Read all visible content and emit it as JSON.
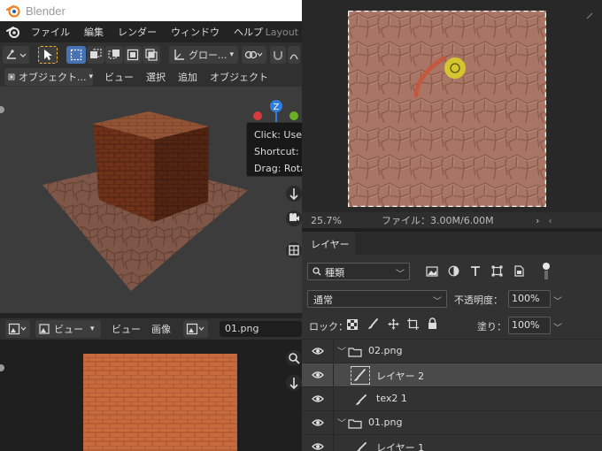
{
  "blender": {
    "app_title": "Blender",
    "menu": [
      "ファイル",
      "編集",
      "レンダー",
      "ウィンドウ",
      "ヘルプ"
    ],
    "workspace_tab": "Layout",
    "tool_dropdown": "グロー...",
    "mode_dropdown": "オブジェクト...",
    "header_menu": [
      "ビュー",
      "選択",
      "追加",
      "オブジェクト"
    ],
    "tooltip": {
      "line1": "Click: Use a",
      "line2": "Shortcut: (C",
      "line3": "Drag: Rota"
    },
    "gizmo_axis_label": "Z",
    "image_editor": {
      "view_dropdown": "ビュー",
      "menu": [
        "ビュー",
        "画像"
      ],
      "filename": "01.png"
    },
    "colors": {
      "cube_side_dark": "#5a2714",
      "cube_side_mid": "#7a3a1e",
      "cube_top": "#8c4728",
      "floor": "#8e6352",
      "texture_orange": "#c56a3e",
      "accent_blue": "#4772b3"
    }
  },
  "photoshop": {
    "status": {
      "zoom": "25.7%",
      "file_info": "ファイル：3.00M/6.00M"
    },
    "panel_tab": "レイヤー",
    "filter_kind": "種類",
    "blend_mode": "通常",
    "opacity_label": "不透明度：",
    "opacity_value": "100%",
    "lock_label": "ロック：",
    "fill_label": "塗り：",
    "fill_value": "100%",
    "layers": [
      {
        "name": "02.png",
        "kind": "group",
        "expanded": true
      },
      {
        "name": "レイヤー 2",
        "kind": "layer",
        "active": true
      },
      {
        "name": "tex2 1",
        "kind": "layer"
      },
      {
        "name": "01.png",
        "kind": "group",
        "expanded": true
      },
      {
        "name": "レイヤー 1",
        "kind": "layer"
      }
    ],
    "colors": {
      "canvas_bg": "#a97665",
      "stroke": "#c8553a",
      "brush_cursor": "#d9cf2a",
      "active_layer": "#4a4a4a"
    }
  }
}
